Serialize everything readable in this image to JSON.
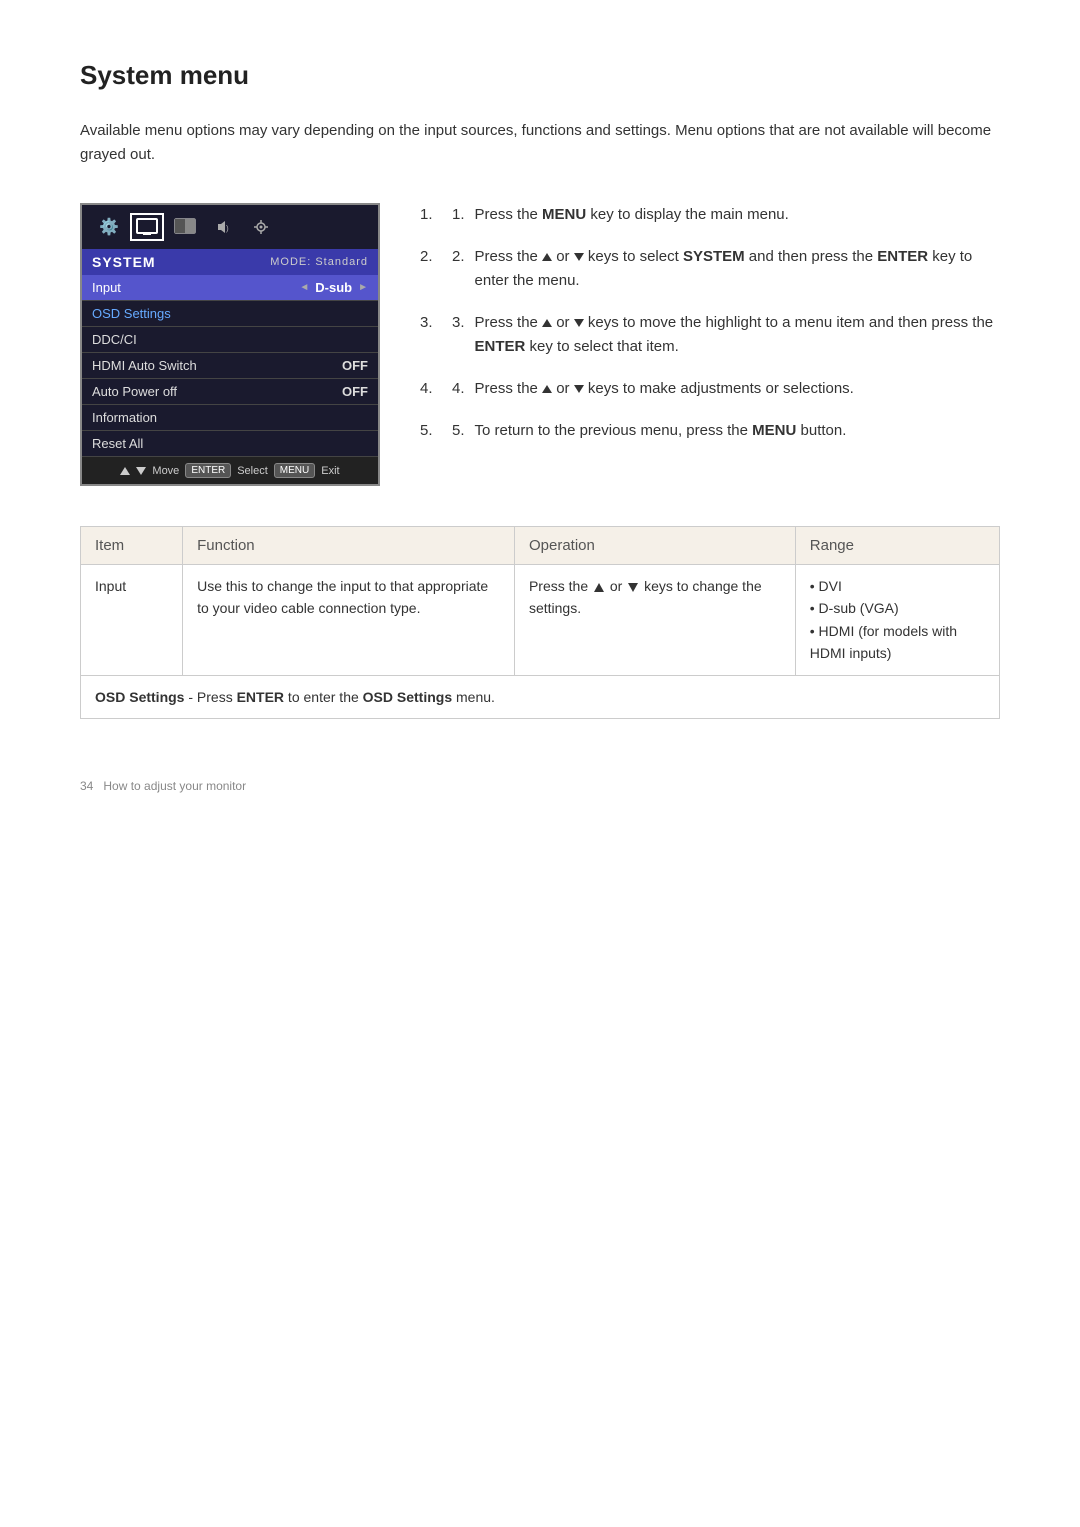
{
  "page": {
    "title": "System menu",
    "intro": "Available menu options may vary depending on the input sources, functions and settings. Menu options that are not available will become grayed out."
  },
  "osd": {
    "header_label": "SYSTEM",
    "mode_label": "MODE: Standard",
    "rows": [
      {
        "label": "Input",
        "value": "D-sub",
        "has_arrows": true,
        "active": true
      },
      {
        "label": "OSD Settings",
        "value": "",
        "has_arrows": false,
        "highlight": true
      },
      {
        "label": "DDC/CI",
        "value": "",
        "has_arrows": false
      },
      {
        "label": "HDMI Auto Switch",
        "value": "OFF",
        "has_arrows": false
      },
      {
        "label": "Auto Power off",
        "value": "OFF",
        "has_arrows": false
      },
      {
        "label": "Information",
        "value": "",
        "has_arrows": false
      },
      {
        "label": "Reset All",
        "value": "",
        "has_arrows": false
      }
    ],
    "footer": {
      "move_label": "Move",
      "select_label": "Select",
      "exit_label": "Exit"
    }
  },
  "instructions": [
    {
      "step": "1",
      "text": "Press the ",
      "bold1": "MENU",
      "text2": " key to display the main menu."
    },
    {
      "step": "2",
      "text": "Press the ▲ or ▼ keys to select ",
      "bold1": "SYSTEM",
      "text2": " and then press the ",
      "bold2": "ENTER",
      "text3": " key to enter the menu."
    },
    {
      "step": "3",
      "text": "Press the ▲ or ▼ keys to move the highlight to a menu item and then press the ",
      "bold1": "ENTER",
      "text2": " key to select that item."
    },
    {
      "step": "4",
      "text": "Press the ▲ or ▼ keys to make adjustments or selections."
    },
    {
      "step": "5",
      "text": "To return to the previous menu, press the ",
      "bold1": "MENU",
      "text2": " button."
    }
  ],
  "table": {
    "headers": [
      "Item",
      "Function",
      "Operation",
      "Range"
    ],
    "rows": [
      {
        "item": "Input",
        "function": "Use this to change the input to that appropriate to your video cable connection type.",
        "operation": "Press the ▲ or ▼ keys to change the settings.",
        "range": "• DVI\n• D-sub (VGA)\n• HDMI (for models with HDMI inputs)"
      }
    ],
    "note": "OSD Settings - Press ENTER to enter the OSD Settings menu."
  },
  "footer": {
    "page_number": "34",
    "page_label": "How to adjust your monitor"
  }
}
